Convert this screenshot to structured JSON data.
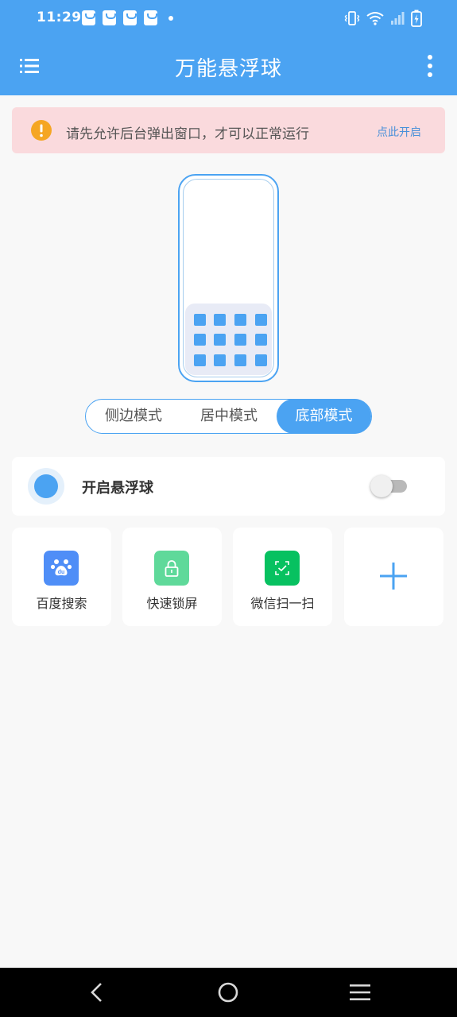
{
  "status_bar": {
    "time": "11:29",
    "notification_icons": [
      "shopping-bag-icon",
      "shopping-bag-icon",
      "shopping-bag-icon",
      "shopping-bag-icon",
      "dot-icon"
    ],
    "system_icons": [
      "vibrate-icon",
      "wifi-icon",
      "signal-icon",
      "battery-charging-icon"
    ]
  },
  "app_bar": {
    "title": "万能悬浮球",
    "left_icon": "list-menu-icon",
    "right_icon": "more-vertical-icon",
    "color": "#4ba3f2"
  },
  "alert": {
    "message": "请先允许后台弹出窗口，才可以正常运行",
    "action": "点此开启",
    "icon": "warning-icon",
    "background": "#fadadd",
    "icon_color": "#f5a623"
  },
  "mode_selector": {
    "options": [
      "侧边模式",
      "居中模式",
      "底部模式"
    ],
    "selected": "底部模式"
  },
  "float_ball": {
    "label": "开启悬浮球",
    "enabled": false
  },
  "shortcuts": [
    {
      "label": "百度搜索",
      "icon": "baidu-paw-icon",
      "color": "#4f8ef7"
    },
    {
      "label": "快速锁屏",
      "icon": "lock-icon",
      "color": "#5fd99a"
    },
    {
      "label": "微信扫一扫",
      "icon": "scan-icon",
      "color": "#07c160"
    },
    {
      "label": "",
      "icon": "plus-icon",
      "color": "#4ba3f2"
    }
  ],
  "nav_bar": {
    "icons": [
      "back-icon",
      "home-icon",
      "recents-icon"
    ]
  }
}
